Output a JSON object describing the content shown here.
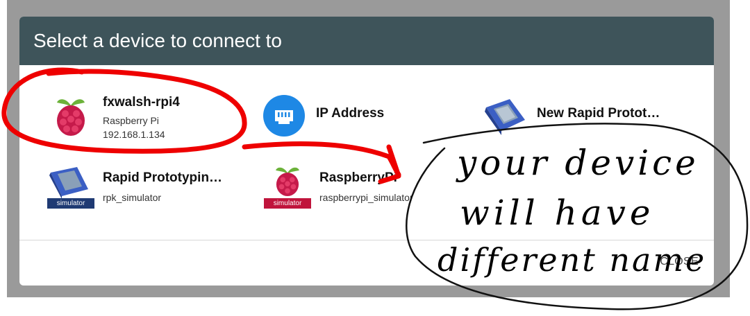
{
  "dialog": {
    "title": "Select a device to connect to",
    "close_label": "CLOSE"
  },
  "devices": [
    {
      "name": "fxwalsh-rpi4",
      "line1": "Raspberry Pi",
      "line2": "192.168.1.134",
      "icon": "raspberry-pi-icon"
    },
    {
      "name": "IP Address",
      "icon": "ethernet-port-icon"
    },
    {
      "name": "New Rapid Protot…",
      "icon": "rapid-prototyping-kit-icon"
    },
    {
      "name": "Rapid Prototypin…",
      "line1": "rpk_simulator",
      "icon": "rapid-prototyping-kit-icon",
      "badge": "simulator"
    },
    {
      "name": "RaspberryPi",
      "line1": "raspberrypi_simulator",
      "icon": "raspberry-pi-icon",
      "badge": "simulator"
    }
  ],
  "annotation": {
    "lines": [
      "your device",
      "will have",
      "different name"
    ]
  },
  "colors": {
    "header_bg": "#3e545a",
    "backdrop": "#9a9a9a",
    "annotation_red": "#ee0000",
    "ip_icon_blue": "#1e88e5",
    "rpk_badge": "#1f3a73",
    "rpi_badge": "#c0143c"
  }
}
